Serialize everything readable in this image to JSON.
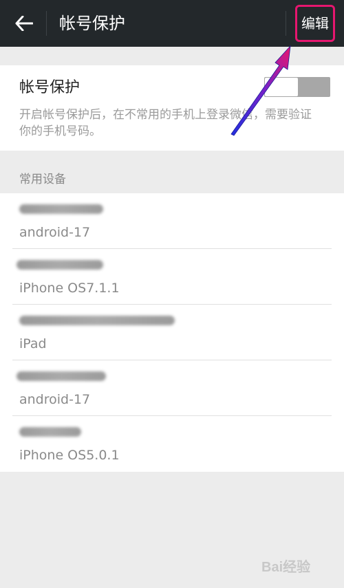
{
  "topbar": {
    "title": "帐号保护",
    "edit_label": "编辑",
    "edit_highlight_color": "#e6166f",
    "background_color": "#23282b"
  },
  "protection": {
    "title": "帐号保护",
    "description": "开启帐号保护后，在不常用的手机上登录微信，需要验证你的手机号码。",
    "toggle_state": "off"
  },
  "devices_section": {
    "header": "常用设备",
    "items": [
      {
        "name_redacted": true,
        "os": "android-17"
      },
      {
        "name_redacted": true,
        "os": "iPhone OS7.1.1"
      },
      {
        "name_redacted": true,
        "os": "iPad"
      },
      {
        "name_redacted": true,
        "os": "android-17"
      },
      {
        "name_redacted": true,
        "os": "iPhone OS5.0.1"
      }
    ]
  },
  "icons": {
    "back": "back-arrow-icon"
  },
  "annotation": {
    "arrow_color_start": "#2230e0",
    "arrow_color_end": "#e6166f"
  },
  "watermark": {
    "text": "Bai经验"
  }
}
